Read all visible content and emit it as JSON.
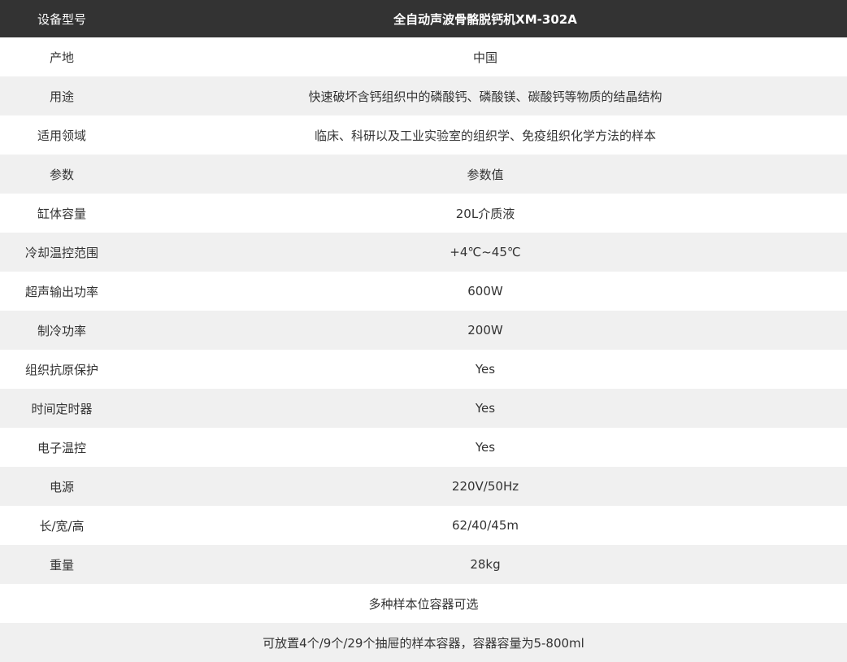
{
  "colors": {
    "header_bg": "#333333",
    "header_text": "#ffffff",
    "row_alt_bg": "#f0f0f0",
    "row_bg": "#ffffff",
    "body_text": "#333333"
  },
  "table": {
    "header": {
      "label": "设备型号",
      "value": "全自动声波骨骼脱钙机XM-302A"
    },
    "rows": [
      {
        "label": "产地",
        "value": "中国"
      },
      {
        "label": "用途",
        "value": "快速破坏含钙组织中的磷酸钙、磷酸镁、碳酸钙等物质的结晶结构"
      },
      {
        "label": "适用领域",
        "value": "临床、科研以及工业实验室的组织学、免疫组织化学方法的样本"
      },
      {
        "label": "参数",
        "value": "参数值"
      },
      {
        "label": "缸体容量",
        "value": "20L介质液"
      },
      {
        "label": "冷却温控范围",
        "value": "+4℃~45℃"
      },
      {
        "label": "超声输出功率",
        "value": "600W"
      },
      {
        "label": "制冷功率",
        "value": "200W"
      },
      {
        "label": "组织抗原保护",
        "value": "Yes"
      },
      {
        "label": "时间定时器",
        "value": "Yes"
      },
      {
        "label": "电子温控",
        "value": "Yes"
      },
      {
        "label": "电源",
        "value": "220V/50Hz"
      },
      {
        "label": "长/宽/高",
        "value": "62/40/45m"
      },
      {
        "label": "重量",
        "value": "28kg"
      }
    ],
    "notes": [
      "多种样本位容器可选",
      "可放置4个/9个/29个抽屉的样本容器，容器容量为5-800ml"
    ]
  }
}
